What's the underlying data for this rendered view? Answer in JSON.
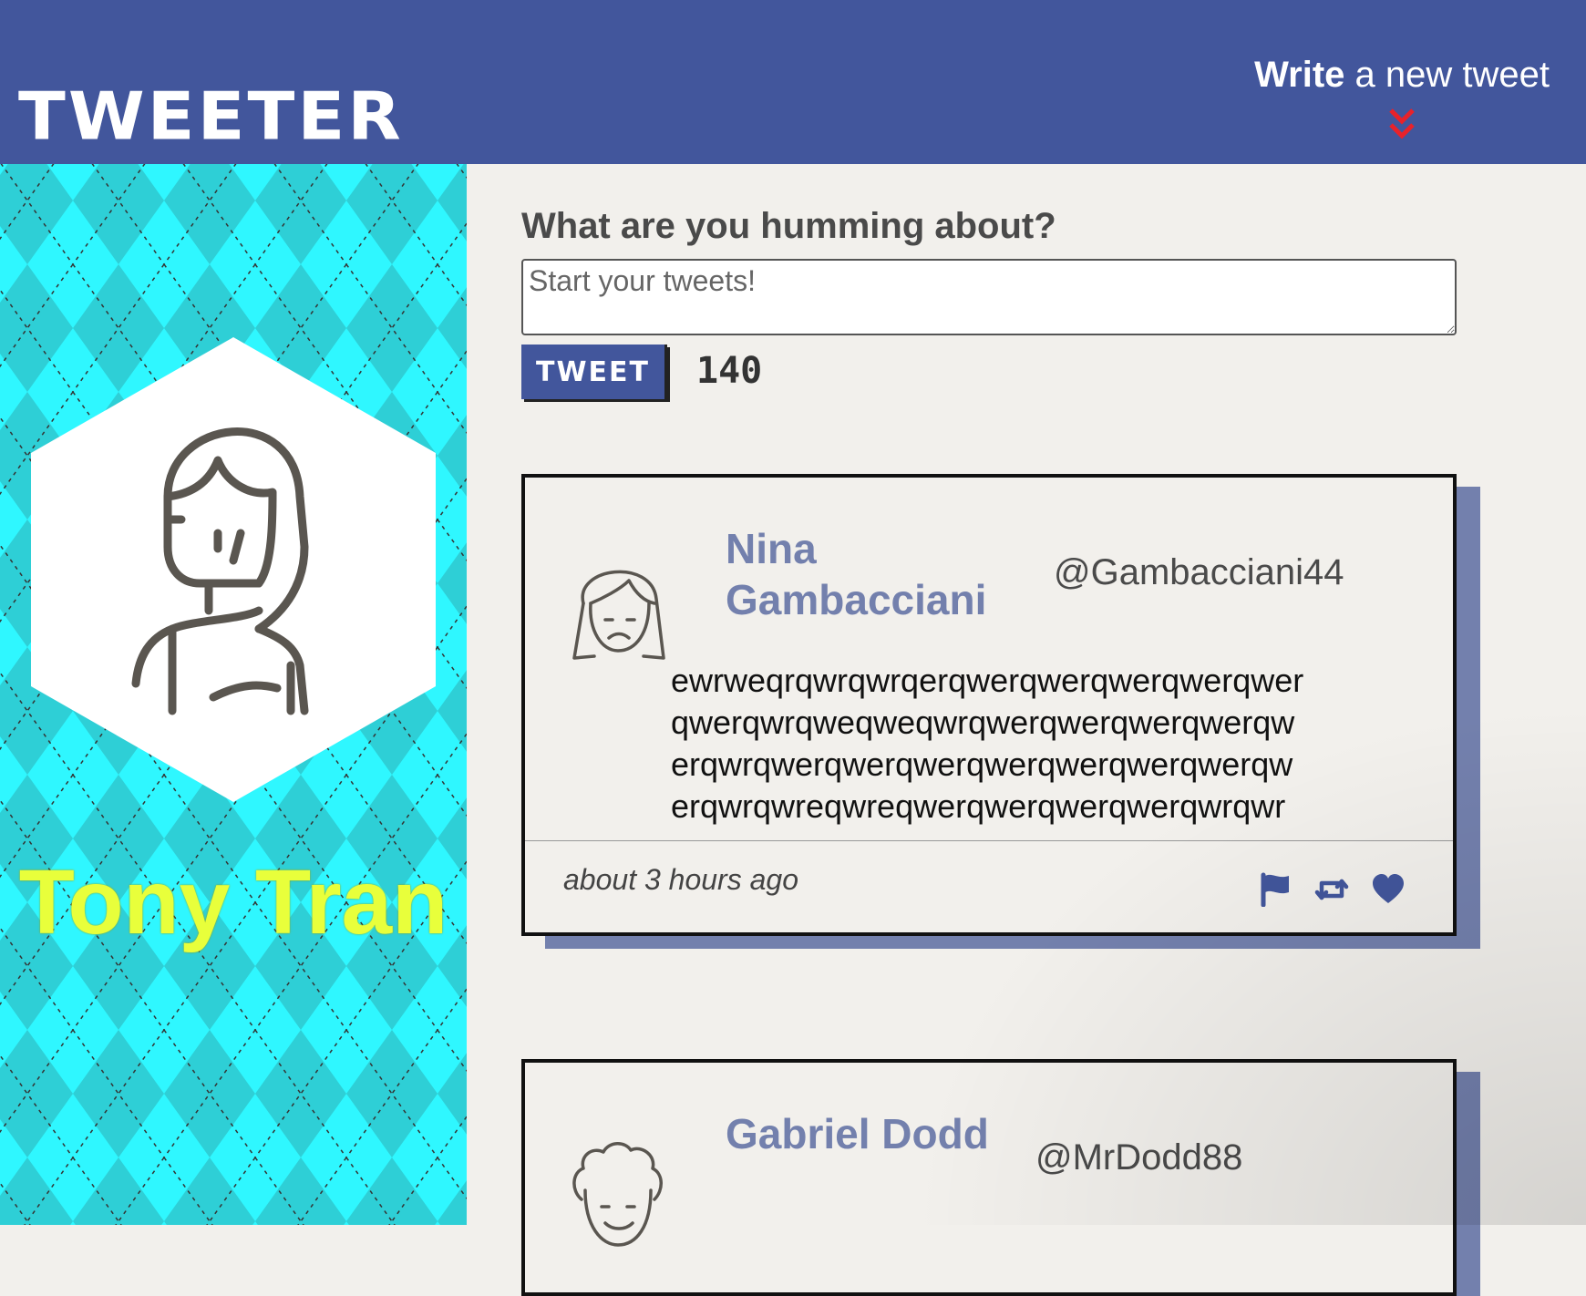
{
  "nav": {
    "brand": "TWEETER",
    "compose_bold": "Write",
    "compose_rest": " a new tweet"
  },
  "profile": {
    "name": "Tony Tran"
  },
  "compose": {
    "title": "What are you humming about?",
    "placeholder": "Start your tweets!",
    "button_label": "TWEET",
    "counter": "140"
  },
  "tweets": [
    {
      "name": "Nina Gambacciani",
      "handle": "@Gambacciani44",
      "text": "ewrweqrqwrqwrqerqwerqwerqwerqwerqwerqwerqwrqweqweqwrqwerqwerqwerqwerqwerqwrqwerqwerqwerqwerqwerqwerqwerqwerqwrqwreqwreqwerqwerqwerqwerqwrqwr",
      "time": "about 3 hours ago"
    },
    {
      "name": "Gabriel Dodd",
      "handle": "@MrDodd88"
    }
  ],
  "icons": {
    "flag": "flag-icon",
    "retweet": "retweet-icon",
    "heart": "heart-icon",
    "chevron": "chevron-double-down-icon"
  },
  "colors": {
    "nav": "#42569c",
    "accent_shadow": "#7380ad",
    "chevron": "#e8222a",
    "profile_name": "#e8ff3b",
    "sidebar_bg": "#2ff7ff"
  }
}
